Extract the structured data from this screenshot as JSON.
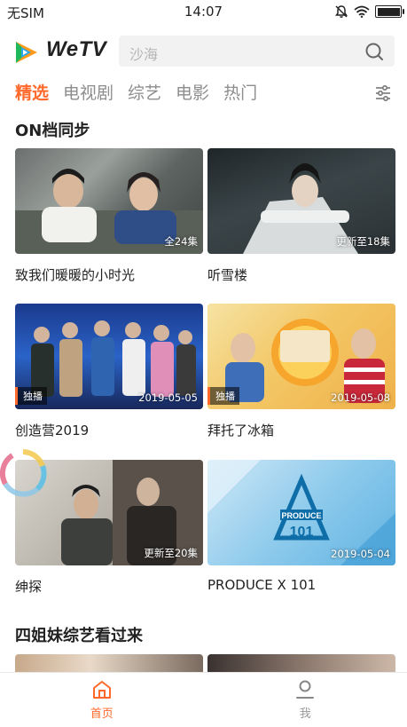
{
  "status_bar": {
    "carrier": "无SIM",
    "time": "14:07",
    "battery_level": 1.0
  },
  "header": {
    "brand": "WeTV",
    "search_placeholder": "沙海"
  },
  "tabs": [
    {
      "label": "精选",
      "active": true
    },
    {
      "label": "电视剧",
      "active": false
    },
    {
      "label": "综艺",
      "active": false
    },
    {
      "label": "电影",
      "active": false
    },
    {
      "label": "热门",
      "active": false
    }
  ],
  "sections": [
    {
      "title": "ON档同步",
      "cards": [
        {
          "title": "致我们暖暖的小时光",
          "overlay": "全24集",
          "badge": ""
        },
        {
          "title": "听雪楼",
          "overlay": "更新至18集",
          "badge": ""
        },
        {
          "title": "创造营2019",
          "overlay": "2019-05-05",
          "badge": "独播"
        },
        {
          "title": "拜托了冰箱",
          "overlay": "2019-05-08",
          "badge": "独播"
        },
        {
          "title": "绅探",
          "overlay": "更新至20集",
          "badge": ""
        },
        {
          "title": "PRODUCE X 101",
          "overlay": "2019-05-04",
          "badge": ""
        }
      ]
    },
    {
      "title": "四姐妹综艺看过来",
      "cards": []
    }
  ],
  "bottom_nav": [
    {
      "label": "首页",
      "icon": "home-icon",
      "active": true
    },
    {
      "label": "我",
      "icon": "user-icon",
      "active": false
    }
  ],
  "colors": {
    "accent": "#ff6a2c",
    "tab_inactive": "#8d8d8d",
    "search_bg": "#f2f2f2"
  }
}
